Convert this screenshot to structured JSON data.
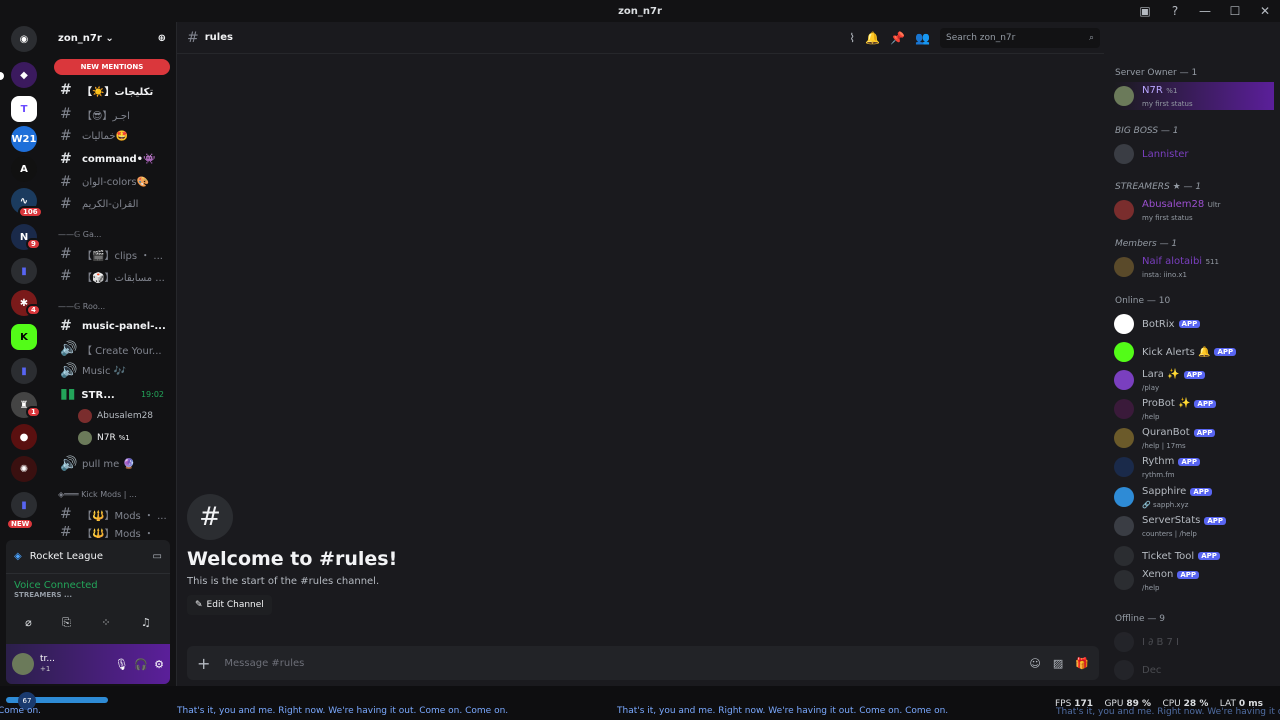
{
  "window": {
    "title": "zon_n7r"
  },
  "server": {
    "name": "zon_n7r",
    "new_mentions": "NEW MENTIONS",
    "new_badge": "NEW"
  },
  "rail_badges": [
    "106",
    "9",
    "4",
    "1"
  ],
  "channels": [
    {
      "label": "【☀️】تكليجات",
      "unread": false
    },
    {
      "label": "【😎】اجـر",
      "unread": false
    },
    {
      "label": "خماليات🤩",
      "unread": false
    },
    {
      "label": "command•👾",
      "unread": true
    },
    {
      "label": "الوان-colors🎨",
      "unread": false
    },
    {
      "label": "القران-الكريم",
      "unread": false
    }
  ],
  "categories": {
    "games": "——𝔾 Ga...",
    "rooms": "——𝔾 Roo...",
    "kick": "◈═══ Kick Mods | ..."
  },
  "channels2": [
    {
      "label": "【🎬】clips ・ ...",
      "unread": false
    },
    {
      "label": "【🎲】مسابقات ...",
      "unread": false
    },
    {
      "label": "music-panel-...",
      "unread": true
    },
    {
      "label": "【 Create Your...",
      "unread": false,
      "voice": true
    },
    {
      "label": "Music 🎶",
      "unread": false,
      "voice": true
    },
    {
      "label": "STR...",
      "unread": false,
      "voice": true,
      "live": true,
      "time": "19:02"
    },
    {
      "label": "pull me 🔮",
      "unread": false,
      "voice": true
    },
    {
      "label": "【🔱】Mods ・ ...",
      "unread": false
    },
    {
      "label": "【🔱】Mods ・",
      "unread": false
    }
  ],
  "voice_users": [
    {
      "name": "Abusalem28"
    },
    {
      "name": "N7R",
      "tag": "%1"
    }
  ],
  "activity": {
    "game": "Rocket League",
    "voice_status": "Voice Connected",
    "voice_channel": "STREAMERS ..."
  },
  "user": {
    "name": "tr...",
    "status": "+1"
  },
  "header": {
    "channel": "rules",
    "search_placeholder": "Search zon_n7r"
  },
  "welcome": {
    "title": "Welcome to #rules!",
    "subtitle": "This is the start of the #rules channel.",
    "edit_label": "Edit Channel"
  },
  "composer": {
    "placeholder": "Message #rules"
  },
  "members": {
    "groups": {
      "owner": "Server Owner — 1",
      "boss": "BIG BOSS — 1",
      "streamers": "STREAMERS ★ — 1",
      "members": "Members — 1",
      "online": "Online — 10",
      "offline": "Offline — 9"
    },
    "list": [
      {
        "name": "N7R",
        "status": "my first status",
        "tag": "%1"
      },
      {
        "name": "Lannister",
        "status": ""
      },
      {
        "name": "Abusalem28",
        "status": "my first status",
        "tag": "Ultr"
      },
      {
        "name": "Naif alotaibi",
        "status": "insta: iino.x1",
        "tag": "511"
      },
      {
        "name": "BotRix",
        "status": "",
        "app": "APP"
      },
      {
        "name": "Kick Alerts 🔔",
        "status": "",
        "app": "APP"
      },
      {
        "name": "Lara ✨",
        "status": "/play",
        "app": "APP"
      },
      {
        "name": "ProBot ✨",
        "status": "/help",
        "app": "APP"
      },
      {
        "name": "QuranBot",
        "status": "/help | 17ms",
        "app": "APP"
      },
      {
        "name": "Rythm",
        "status": "rythm.fm",
        "app": "APP"
      },
      {
        "name": "Sapphire",
        "status": "🔗 sapph.xyz",
        "app": "APP"
      },
      {
        "name": "ServerStats",
        "status": "counters | /help",
        "app": "APP"
      },
      {
        "name": "Ticket Tool",
        "status": "",
        "app": "APP"
      },
      {
        "name": "Xenon",
        "status": "/help",
        "app": "APP"
      },
      {
        "name": "I ∂ B 7 I",
        "status": ""
      },
      {
        "name": "Dec",
        "status": ""
      }
    ]
  },
  "overlay": {
    "ticker": "That's it, you and me. Right now. We're having it out. Come on. Come on.",
    "ticker_left": "Come on.",
    "ticker_right": "That's it, you and me. Right now. We're having it out. Come",
    "fps_label": "FPS",
    "fps": "171",
    "gpu_label": "GPU",
    "gpu": "89 %",
    "cpu_label": "CPU",
    "cpu": "28 %",
    "lat_label": "LAT",
    "lat": "0 ms",
    "level": "67"
  }
}
